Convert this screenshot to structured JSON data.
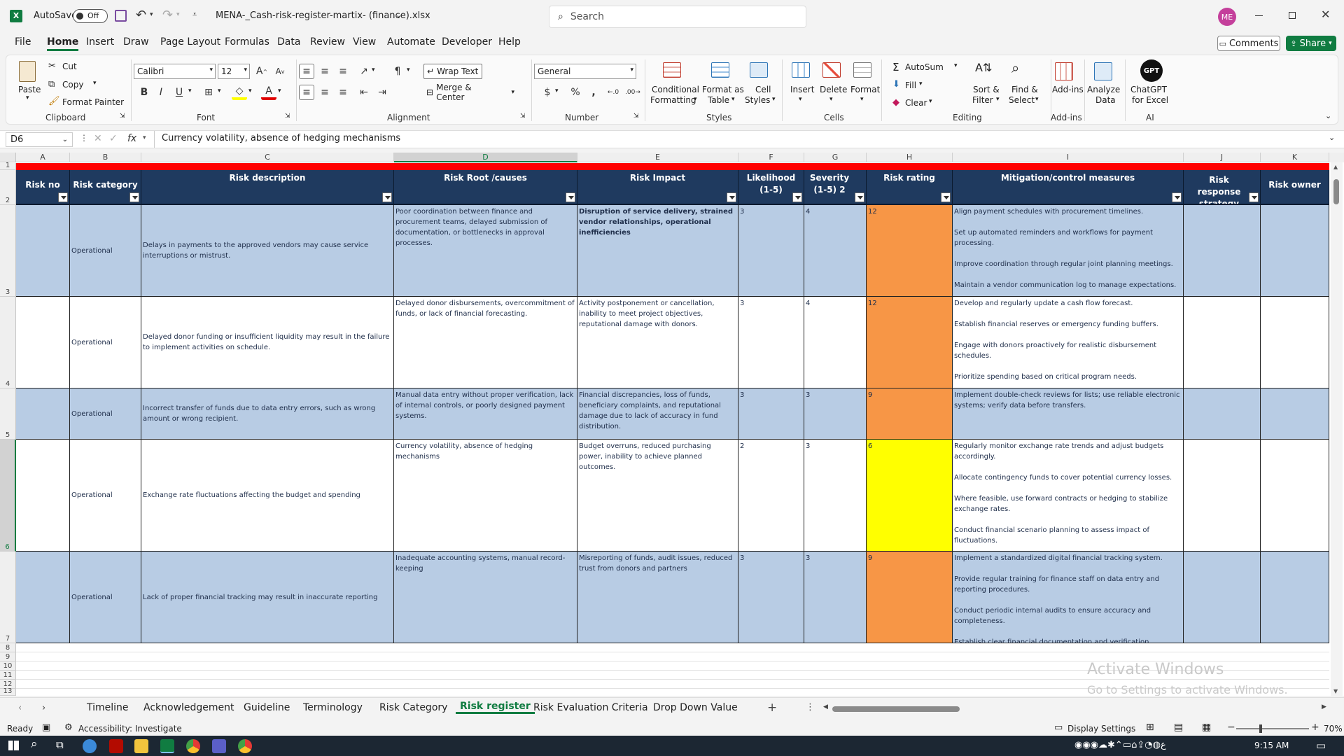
{
  "title_bar": {
    "autosave_label": "AutoSave",
    "autosave_state": "Off",
    "file_name": "MENA-_Cash-risk-register-martix- (finance).xlsx",
    "search_placeholder": "Search",
    "avatar_initials": "ME"
  },
  "menu": [
    "File",
    "Home",
    "Insert",
    "Draw",
    "Page Layout",
    "Formulas",
    "Data",
    "Review",
    "View",
    "Automate",
    "Developer",
    "Help"
  ],
  "menu_right": {
    "comments": "Comments",
    "share": "Share"
  },
  "ribbon": {
    "clipboard": {
      "paste": "Paste",
      "cut": "Cut",
      "copy": "Copy",
      "format_painter": "Format Painter",
      "group": "Clipboard"
    },
    "font": {
      "name": "Calibri",
      "size": "12",
      "group": "Font"
    },
    "alignment": {
      "wrap_text": "Wrap Text",
      "merge_center": "Merge & Center",
      "group": "Alignment"
    },
    "number": {
      "format": "General",
      "group": "Number"
    },
    "styles": {
      "conditional": "Conditional",
      "formatting": "Formatting",
      "format_as": "Format as",
      "table": "Table",
      "cell": "Cell",
      "styles_label": "Styles",
      "group": "Styles"
    },
    "cells": {
      "insert": "Insert",
      "delete": "Delete",
      "format": "Format",
      "group": "Cells"
    },
    "editing": {
      "autosum": "AutoSum",
      "fill": "Fill",
      "clear": "Clear",
      "sort": "Sort &",
      "filter": "Filter",
      "find": "Find &",
      "select": "Select",
      "group": "Editing"
    },
    "addins": {
      "addins": "Add-ins",
      "group": "Add-ins"
    },
    "analyze": {
      "line1": "Analyze",
      "line2": "Data"
    },
    "chatgpt": {
      "badge": "GPT",
      "line1": "ChatGPT",
      "line2": "for Excel",
      "group": "AI"
    }
  },
  "formula_bar": {
    "name_box": "D6",
    "fx": "fx",
    "content": "Currency volatility, absence of hedging mechanisms"
  },
  "columns": [
    "A",
    "B",
    "C",
    "D",
    "E",
    "F",
    "G",
    "H",
    "I",
    "J",
    "K"
  ],
  "row_numbers": [
    "1",
    "2",
    "3",
    "4",
    "5",
    "6",
    "7",
    "8",
    "9",
    "10",
    "11",
    "12",
    "13"
  ],
  "headers": [
    "Risk no",
    "Risk category",
    "Risk description",
    "Risk Root /causes",
    "Risk Impact",
    "Likelihood (1-5)",
    "Severity (1-5) 2",
    "Risk rating",
    "Mitigation/control measures",
    "Risk response strategy",
    "Risk owner"
  ],
  "rows": [
    {
      "category": "Operational",
      "description": " Delays in payments to the approved vendors may cause service interruptions or mistrust.",
      "causes": "Poor coordination between finance and procurement teams, delayed submission of documentation, or bottlenecks in approval processes.",
      "impact": " Disruption of service delivery, strained vendor relationships, operational inefficiencies",
      "likelihood": "3",
      "severity": "4",
      "rating": "12",
      "rating_color": "#f79646",
      "mitigation": [
        " Align payment schedules with procurement timelines.",
        "Set up automated reminders and workflows for payment processing.",
        "Improve coordination through regular joint planning meetings.",
        "Maintain a vendor communication log to manage expectations."
      ]
    },
    {
      "category": "Operational",
      "description": "Delayed donor funding or insufficient liquidity may result in the failure to implement activities on schedule.",
      "causes": "Delayed donor disbursements, overcommitment of funds, or lack of financial forecasting.",
      "impact": " Activity postponement or cancellation, inability to meet project objectives, reputational damage with donors.",
      "likelihood": "3",
      "severity": "4",
      "rating": "12",
      "rating_color": "#f79646",
      "mitigation": [
        " Develop and regularly update a cash flow forecast.",
        "Establish financial reserves or emergency funding buffers.",
        "Engage with donors proactively for realistic disbursement schedules.",
        "Prioritize spending based on critical program needs."
      ]
    },
    {
      "category": "Operational",
      "description": "Incorrect transfer of funds due to data entry errors, such as wrong amount or wrong recipient.",
      "causes": "Manual data entry without proper verification, lack of internal controls, or poorly designed payment systems.",
      "impact": " Financial discrepancies, loss of funds, beneficiary complaints, and reputational damage due to lack of accuracy in fund distribution.",
      "likelihood": "3",
      "severity": "3",
      "rating": "9",
      "rating_color": "#f79646",
      "mitigation": [
        "Implement double-check reviews for lists; use reliable electronic systems; verify data before transfers."
      ]
    },
    {
      "category": "Operational",
      "description": " Exchange rate fluctuations affecting the budget and spending",
      "causes": "Currency volatility, absence of hedging mechanisms",
      "impact": "Budget overruns, reduced purchasing power, inability to achieve planned outcomes.",
      "likelihood": "2",
      "severity": "3",
      "rating": "6",
      "rating_color": "#ffff00",
      "mitigation": [
        " Regularly monitor exchange rate trends and adjust budgets accordingly.",
        "Allocate contingency funds to cover potential currency losses.",
        "Where feasible, use forward contracts or hedging to stabilize exchange rates.",
        "Conduct financial scenario planning to assess impact of fluctuations."
      ]
    },
    {
      "category": "Operational",
      "description": "Lack of proper financial tracking may result in inaccurate reporting",
      "causes": "Inadequate accounting systems, manual record-keeping",
      "impact": "Misreporting of funds, audit issues, reduced trust from donors and partners",
      "likelihood": "3",
      "severity": "3",
      "rating": "9",
      "rating_color": "#f79646",
      "mitigation": [
        " Implement a standardized digital financial tracking system.",
        "Provide regular training for finance staff on data entry and reporting procedures.",
        "Conduct periodic internal audits to ensure accuracy and completeness.",
        "Establish clear financial documentation and verification protocols."
      ]
    }
  ],
  "sheet_tabs": [
    "Timeline",
    "Acknowledgement",
    "Guideline",
    "Terminology",
    "Risk Category",
    "Risk register",
    "Risk Evaluation Criteria",
    "Drop Down Value"
  ],
  "active_tab": "Risk register",
  "watermark": {
    "line1": "Activate Windows",
    "line2": "Go to Settings to activate Windows."
  },
  "status": {
    "ready": "Ready",
    "accessibility": "Accessibility: Investigate",
    "display_settings": "Display Settings",
    "zoom": "70%"
  },
  "taskbar": {
    "time": "9:15 AM"
  }
}
